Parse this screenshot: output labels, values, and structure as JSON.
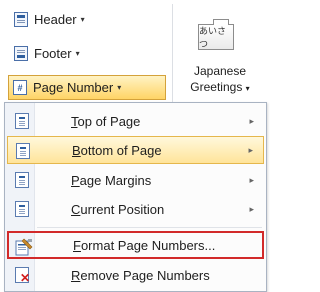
{
  "ribbon": {
    "header_label": "Header",
    "footer_label": "Footer",
    "page_number_label": "Page Number",
    "page_number_glyph": "#",
    "dropdown_arrow": "▾",
    "japanese_line1": "Japanese",
    "japanese_line2": "Greetings",
    "japanese_icon_text": "あいさつ"
  },
  "menu": {
    "submenu_arrow": "▸",
    "items": [
      {
        "accel": "T",
        "rest": "op of Page",
        "has_submenu": true
      },
      {
        "accel": "B",
        "rest": "ottom of Page",
        "has_submenu": true
      },
      {
        "accel": "P",
        "rest": "age Margins",
        "has_submenu": true
      },
      {
        "accel": "C",
        "rest": "urrent Position",
        "has_submenu": true
      },
      {
        "accel": "F",
        "rest": "ormat Page Numbers...",
        "has_submenu": false
      },
      {
        "accel": "R",
        "rest": "emove Page Numbers",
        "has_submenu": false
      }
    ]
  },
  "colors": {
    "highlight": "#ffe49a",
    "selection_outline": "#d22a2a",
    "icon_blue": "#2f5f9f"
  },
  "icons": {
    "header": "header-icon",
    "footer": "footer-icon",
    "page_number": "page-number-icon",
    "japanese": "japanese-greetings-icon",
    "format": "format-page-numbers-icon",
    "remove": "remove-page-numbers-icon"
  }
}
